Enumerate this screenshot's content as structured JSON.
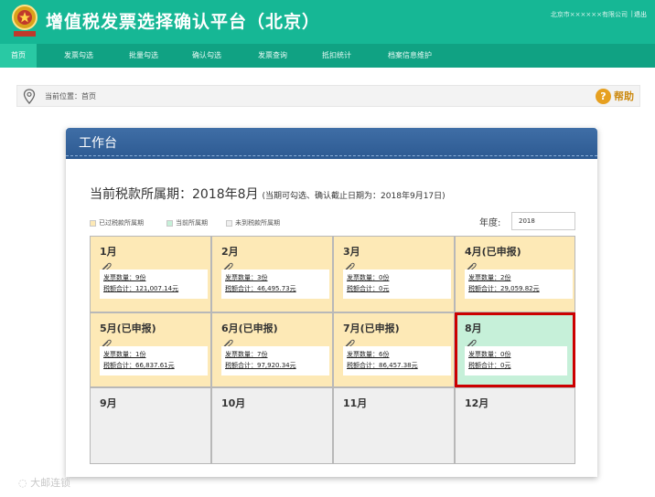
{
  "app": {
    "title": "增值税发票选择确认平台（北京）",
    "user_info": "北京市××××××有限公司",
    "separator": "|",
    "logout_label": "退出"
  },
  "nav": {
    "items": [
      {
        "label": "首页",
        "active": true
      },
      {
        "label": "发票勾选",
        "active": false
      },
      {
        "label": "批量勾选",
        "active": false
      },
      {
        "label": "确认勾选",
        "active": false
      },
      {
        "label": "发票查询",
        "active": false
      },
      {
        "label": "抵扣统计",
        "active": false
      },
      {
        "label": "档案信息维护",
        "active": false
      }
    ]
  },
  "breadcrumb": {
    "text": "当前位置：首页",
    "help_label": "帮助",
    "help_icon": "question-circle-icon",
    "pin_icon": "map-pin-icon"
  },
  "panel": {
    "title": "工作台",
    "period_main": "当前税款所属期：2018年8月",
    "period_note": "(当期可勾选、确认截止日期为：2018年9月17日)",
    "legend": [
      {
        "label": "已过税款所属期",
        "color": "#fde9b6"
      },
      {
        "label": "当前所属期",
        "color": "#c6f0d9"
      },
      {
        "label": "未到税款所属期",
        "color": "#efefef"
      }
    ],
    "year_label": "年度:",
    "year_value": "2018"
  },
  "months": [
    {
      "label": "1月",
      "status": "past",
      "count": "发票数量：9份",
      "amount": "税额合计：121,007.14元"
    },
    {
      "label": "2月",
      "status": "past",
      "count": "发票数量：3份",
      "amount": "税额合计：46,495.73元"
    },
    {
      "label": "3月",
      "status": "past",
      "count": "发票数量：0份",
      "amount": "税额合计：0元"
    },
    {
      "label": "4月(已申报)",
      "status": "past",
      "count": "发票数量：2份",
      "amount": "税额合计：29,059.82元"
    },
    {
      "label": "5月(已申报)",
      "status": "past",
      "count": "发票数量：1份",
      "amount": "税额合计：66,837.61元"
    },
    {
      "label": "6月(已申报)",
      "status": "past",
      "count": "发票数量：7份",
      "amount": "税额合计：97,920.34元"
    },
    {
      "label": "7月(已申报)",
      "status": "past",
      "count": "发票数量：6份",
      "amount": "税额合计：86,457.38元"
    },
    {
      "label": "8月",
      "status": "current",
      "count": "发票数量：0份",
      "amount": "税额合计：0元"
    },
    {
      "label": "9月",
      "status": "future"
    },
    {
      "label": "10月",
      "status": "future"
    },
    {
      "label": "11月",
      "status": "future"
    },
    {
      "label": "12月",
      "status": "future"
    }
  ],
  "watermark": "大邮连锁",
  "colors": {
    "header": "#16b795",
    "nav": "#10a283",
    "nav_active": "#29c9a4",
    "panel_header": "#2d5a92",
    "selected_border": "#cc0000"
  }
}
